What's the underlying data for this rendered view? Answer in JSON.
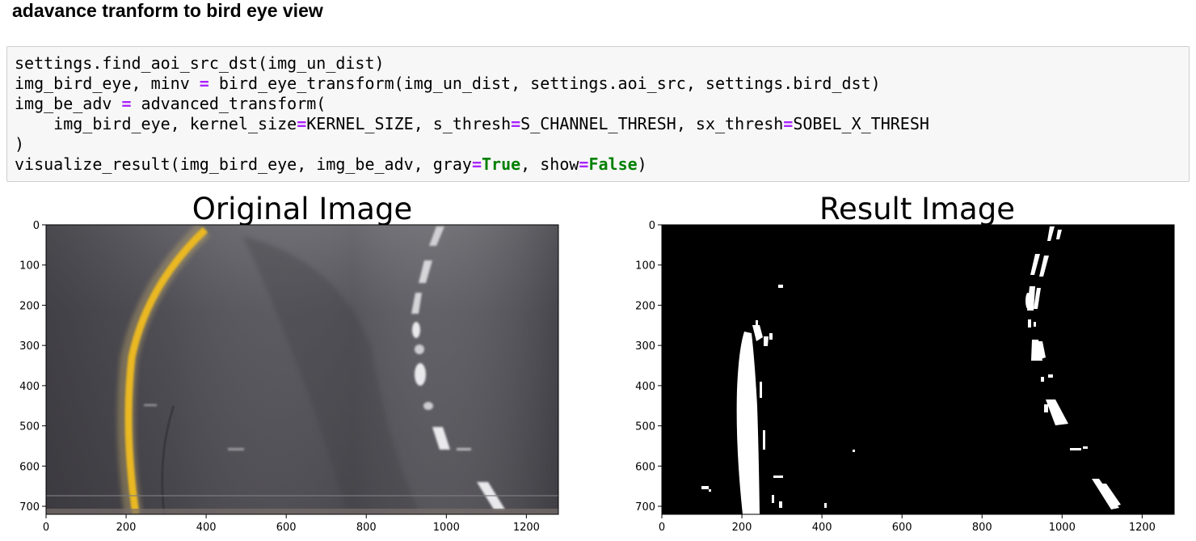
{
  "markdown_heading": "adavance tranform to bird eye view",
  "code_cell": {
    "lines": [
      [
        {
          "t": "settings.find_aoi_src_dst(img_un_dist)"
        }
      ],
      [
        {
          "t": "img_bird_eye, minv "
        },
        {
          "t": "=",
          "c": "op"
        },
        {
          "t": " bird_eye_transform(img_un_dist, settings.aoi_src, settings.bird_dst)"
        }
      ],
      [
        {
          "t": "img_be_adv "
        },
        {
          "t": "=",
          "c": "op"
        },
        {
          "t": " advanced_transform("
        }
      ],
      [
        {
          "t": "    img_bird_eye, kernel_size"
        },
        {
          "t": "=",
          "c": "op"
        },
        {
          "t": "KERNEL_SIZE, s_thresh"
        },
        {
          "t": "=",
          "c": "op"
        },
        {
          "t": "S_CHANNEL_THRESH, sx_thresh"
        },
        {
          "t": "=",
          "c": "op"
        },
        {
          "t": "SOBEL_X_THRESH"
        }
      ],
      [
        {
          "t": ")"
        }
      ],
      [
        {
          "t": "visualize_result(img_bird_eye, img_be_adv, gray"
        },
        {
          "t": "=",
          "c": "op"
        },
        {
          "t": "True",
          "c": "kw"
        },
        {
          "t": ", show"
        },
        {
          "t": "=",
          "c": "op"
        },
        {
          "t": "False",
          "c": "kw"
        },
        {
          "t": ")"
        }
      ]
    ]
  },
  "output_figure": {
    "subplots": [
      {
        "title": "Original Image",
        "image": "camera frame of road, bird's-eye view",
        "x_ticks": [
          "0",
          "200",
          "400",
          "600",
          "800",
          "1000",
          "1200"
        ],
        "y_ticks": [
          "0",
          "100",
          "200",
          "300",
          "400",
          "500",
          "600",
          "700"
        ]
      },
      {
        "title": "Result Image",
        "image": "binary lane-line mask",
        "x_ticks": [
          "0",
          "200",
          "400",
          "600",
          "800",
          "1000",
          "1200"
        ],
        "y_ticks": [
          "0",
          "100",
          "200",
          "300",
          "400",
          "500",
          "600",
          "700"
        ]
      }
    ]
  },
  "colors": {
    "operator": "#aa22ff",
    "keyword": "#008000",
    "cell_background": "#f7f7f7",
    "cell_border": "#cfcfcf",
    "lane_yellow": "#e9b820",
    "road_gray": "#54535a"
  }
}
